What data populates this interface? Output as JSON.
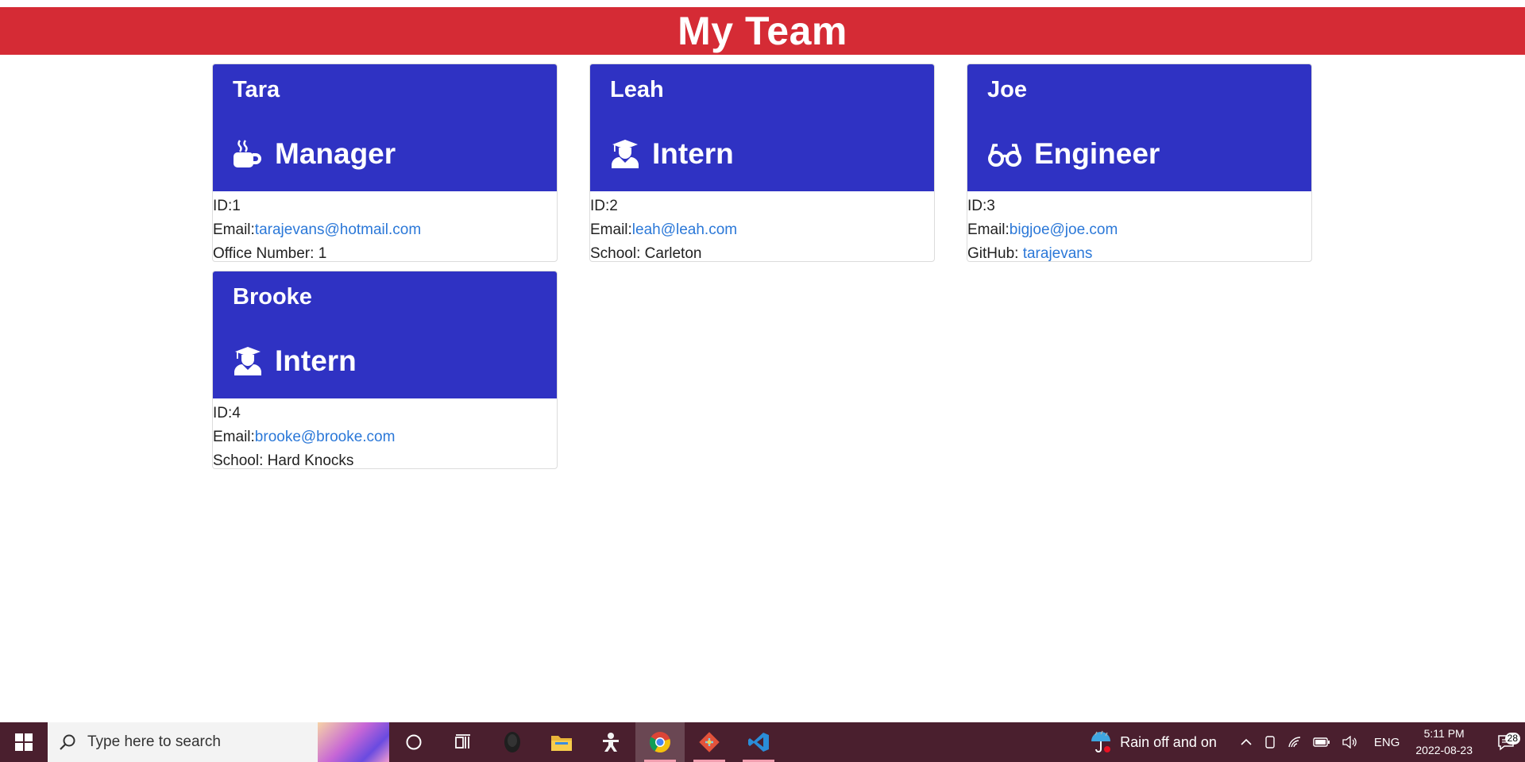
{
  "page": {
    "title": "My Team"
  },
  "employees": [
    {
      "name": "Tara",
      "role": "Manager",
      "role_icon": "coffee-mug-icon",
      "id_label": "ID:1",
      "email_label": "Email:",
      "email": "tarajevans@hotmail.com",
      "extra_label": "Office Number: 1",
      "extra_link": ""
    },
    {
      "name": "Leah",
      "role": "Intern",
      "role_icon": "graduate-icon",
      "id_label": "ID:2",
      "email_label": "Email:",
      "email": "leah@leah.com",
      "extra_label": "School: Carleton",
      "extra_link": ""
    },
    {
      "name": "Joe",
      "role": "Engineer",
      "role_icon": "glasses-icon",
      "id_label": "ID:3",
      "email_label": "Email:",
      "email": "bigjoe@joe.com",
      "extra_label": "GitHub: ",
      "extra_link": "tarajevans"
    },
    {
      "name": "Brooke",
      "role": "Intern",
      "role_icon": "graduate-icon",
      "id_label": "ID:4",
      "email_label": "Email:",
      "email": "brooke@brooke.com",
      "extra_label": "School: Hard Knocks",
      "extra_link": ""
    }
  ],
  "taskbar": {
    "search_placeholder": "Type here to search",
    "weather": "Rain off and on",
    "language": "ENG",
    "time": "5:11 PM",
    "date": "2022-08-23",
    "notifications": "28",
    "apps": [
      "cortana-icon",
      "task-view-icon",
      "app-icon",
      "file-explorer-icon",
      "figure-app-icon",
      "chrome-icon",
      "git-icon",
      "vscode-icon"
    ]
  },
  "colors": {
    "banner": "#d52b35",
    "card_header": "#2f32c3",
    "link": "#2b78d8",
    "taskbar": "#4a1f2e"
  }
}
